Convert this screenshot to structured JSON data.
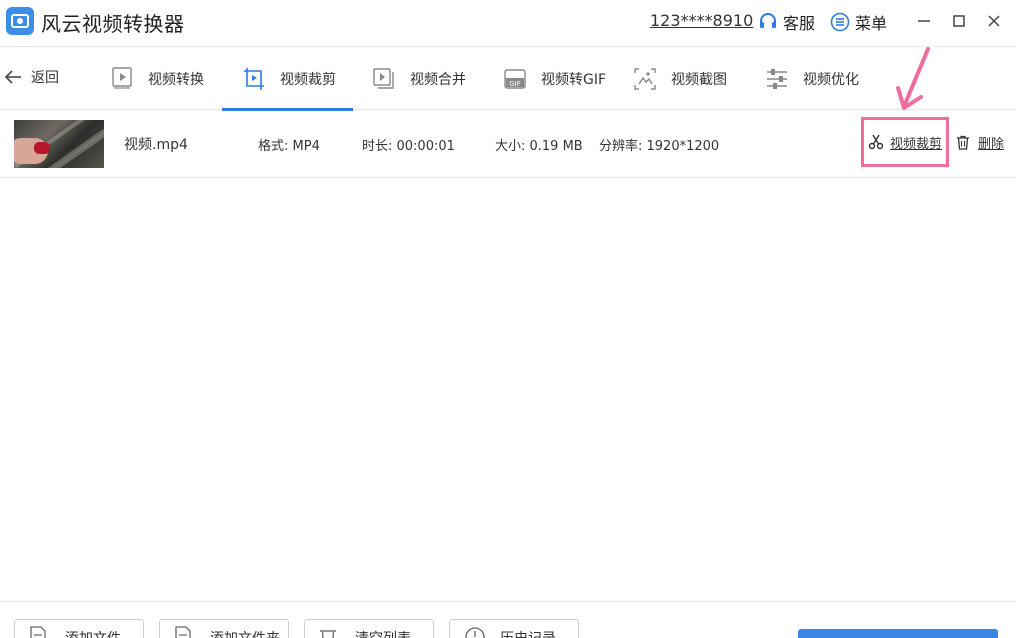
{
  "app": {
    "title": "风云视频转换器"
  },
  "header": {
    "account": "123****8910",
    "service_label": "客服",
    "menu_label": "菜单"
  },
  "nav": {
    "back_label": "返回",
    "tabs": [
      {
        "label": "视频转换",
        "icon": "video-convert-icon"
      },
      {
        "label": "视频裁剪",
        "icon": "video-crop-icon",
        "active": true
      },
      {
        "label": "视频合并",
        "icon": "video-merge-icon"
      },
      {
        "label": "视频转GIF",
        "icon": "gif-icon"
      },
      {
        "label": "视频截图",
        "icon": "screenshot-icon"
      },
      {
        "label": "视频优化",
        "icon": "sliders-icon"
      }
    ]
  },
  "file": {
    "name": "视频.mp4",
    "format": "格式: MP4",
    "duration": "时长: 00:00:01",
    "size": "大小: 0.19 MB",
    "resolution": "分辨率: 1920*1200",
    "crop_label": "视频裁剪",
    "delete_label": "删除"
  },
  "footer": {
    "add_file": "添加文件",
    "add_folder": "添加文件夹",
    "clear_list": "清空列表",
    "history": "历史记录"
  },
  "colors": {
    "accent": "#2f7ae5",
    "highlight": "#ef6d9d",
    "primary_button": "#3a86e6"
  }
}
